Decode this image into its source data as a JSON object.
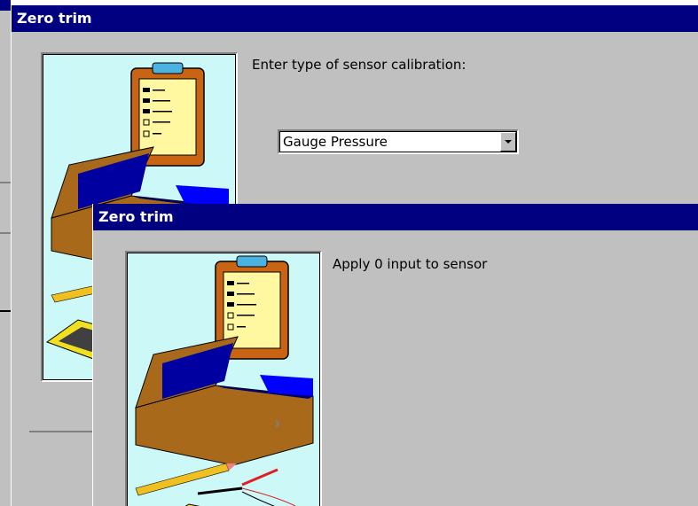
{
  "window_back": {
    "title": "Zero trim",
    "prompt": "Enter type of sensor calibration:",
    "calibration_type": {
      "selected": "Gauge Pressure"
    }
  },
  "window_front": {
    "title": "Zero trim",
    "prompt": "Apply 0 input to sensor"
  },
  "colors": {
    "titlebar": "#000080",
    "window_bg": "#c0c0c0",
    "picture_bg": "#ccf8f8"
  },
  "icons": [
    "clipboard-checklist",
    "toolbox",
    "pencil",
    "multimeter-probes"
  ]
}
